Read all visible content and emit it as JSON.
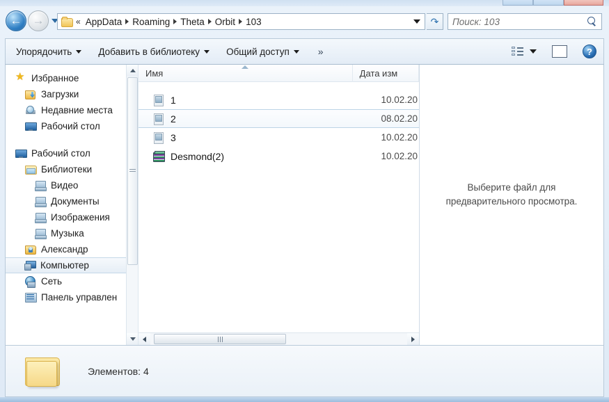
{
  "window": {
    "controls": [
      "minimize-button",
      "maximize-button",
      "close-button"
    ]
  },
  "navigation": {
    "back_label": "←",
    "forward_label": "→",
    "recent_dropdown": "chevron-down-icon",
    "refresh_label": "↺"
  },
  "breadcrumb": {
    "overflow": "«",
    "items": [
      "AppData",
      "Roaming",
      "Theta",
      "Orbit",
      "103"
    ]
  },
  "search": {
    "placeholder": "Поиск: 103",
    "value": ""
  },
  "toolbar": {
    "items": [
      {
        "label": "Упорядочить",
        "has_caret": true
      },
      {
        "label": "Добавить в библиотеку",
        "has_caret": true
      },
      {
        "label": "Общий доступ",
        "has_caret": true
      }
    ],
    "overflow": "»",
    "help_label": "?"
  },
  "sidebar": {
    "items": [
      {
        "label": "Избранное",
        "icon": "star-icon",
        "level": 0,
        "selected": false
      },
      {
        "label": "Загрузки",
        "icon": "downloads-icon",
        "level": 1,
        "selected": false
      },
      {
        "label": "Недавние места",
        "icon": "recent-places-icon",
        "level": 1,
        "selected": false
      },
      {
        "label": "Рабочий стол",
        "icon": "desktop-icon",
        "level": 1,
        "selected": false
      },
      {
        "label": "Рабочий стол",
        "icon": "desktop-icon",
        "level": 0,
        "selected": false
      },
      {
        "label": "Библиотеки",
        "icon": "libraries-icon",
        "level": 1,
        "selected": false
      },
      {
        "label": "Видео",
        "icon": "video-icon",
        "level": 2,
        "selected": false
      },
      {
        "label": "Документы",
        "icon": "documents-icon",
        "level": 2,
        "selected": false
      },
      {
        "label": "Изображения",
        "icon": "pictures-icon",
        "level": 2,
        "selected": false
      },
      {
        "label": "Музыка",
        "icon": "music-icon",
        "level": 2,
        "selected": false
      },
      {
        "label": "Александр",
        "icon": "user-folder-icon",
        "level": 1,
        "selected": false
      },
      {
        "label": "Компьютер",
        "icon": "computer-icon",
        "level": 1,
        "selected": true
      },
      {
        "label": "Сеть",
        "icon": "network-icon",
        "level": 1,
        "selected": false
      },
      {
        "label": "Панель управлен",
        "icon": "control-panel-icon",
        "level": 1,
        "selected": false
      }
    ]
  },
  "filelist": {
    "columns": [
      {
        "label": "Имя",
        "sorted": "asc"
      },
      {
        "label": "Дата изм",
        "sorted": ""
      }
    ],
    "rows": [
      {
        "name": "1",
        "date": "10.02.20",
        "icon": "document-file-icon",
        "hover": false
      },
      {
        "name": "2",
        "date": "08.02.20",
        "icon": "document-file-icon",
        "hover": true
      },
      {
        "name": "3",
        "date": "10.02.20",
        "icon": "document-file-icon",
        "hover": false
      },
      {
        "name": "Desmond(2)",
        "date": "10.02.20",
        "icon": "archive-file-icon",
        "hover": false
      }
    ]
  },
  "preview": {
    "message_line1": "Выберите файл для",
    "message_line2": "предварительного просмотра."
  },
  "statusbar": {
    "text": "Элементов: 4"
  },
  "colors": {
    "accent": "#2a6fb5",
    "chrome": "#dfeaf6",
    "selection": "#e6eef6"
  }
}
